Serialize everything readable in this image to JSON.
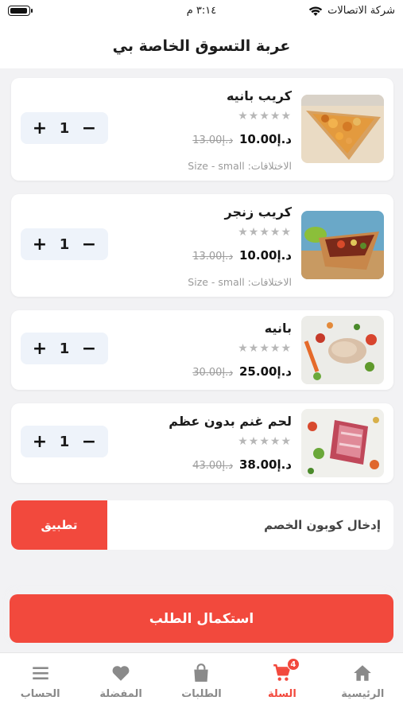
{
  "status_bar": {
    "carrier": "شركة الاتصالات",
    "time": "٣:١٤ م"
  },
  "header": {
    "title": "عربة التسوق الخاصة بي"
  },
  "cart": {
    "items": [
      {
        "name": "كريب بانيه",
        "price": "د.إ10.00",
        "old_price": "د.إ13.00",
        "variant": "الاختلافات: Size - small",
        "quantity": "1"
      },
      {
        "name": "كريب زنجر",
        "price": "د.إ10.00",
        "old_price": "د.إ13.00",
        "variant": "الاختلافات: Size - small",
        "quantity": "1"
      },
      {
        "name": "بانيه",
        "price": "د.إ25.00",
        "old_price": "د.إ30.00",
        "quantity": "1"
      },
      {
        "name": "لحم غنم بدون عظم",
        "price": "د.إ38.00",
        "old_price": "د.إ43.00",
        "quantity": "1"
      }
    ],
    "stars": "★★★★★",
    "plus": "+",
    "minus": "−"
  },
  "coupon": {
    "placeholder": "إدخال كوبون الخصم",
    "apply_label": "تطبيق"
  },
  "checkout": {
    "label": "استكمال الطلب"
  },
  "tabs": [
    {
      "label": "الرئيسية",
      "icon": "home-icon"
    },
    {
      "label": "السلة",
      "icon": "cart-icon",
      "badge": "4",
      "active": true
    },
    {
      "label": "الطلبات",
      "icon": "bag-icon"
    },
    {
      "label": "المفضلة",
      "icon": "heart-icon"
    },
    {
      "label": "الحساب",
      "icon": "menu-icon"
    }
  ],
  "colors": {
    "accent": "#f2493d",
    "stepper_bg": "#eef3fa",
    "background": "#f2f2f4"
  }
}
